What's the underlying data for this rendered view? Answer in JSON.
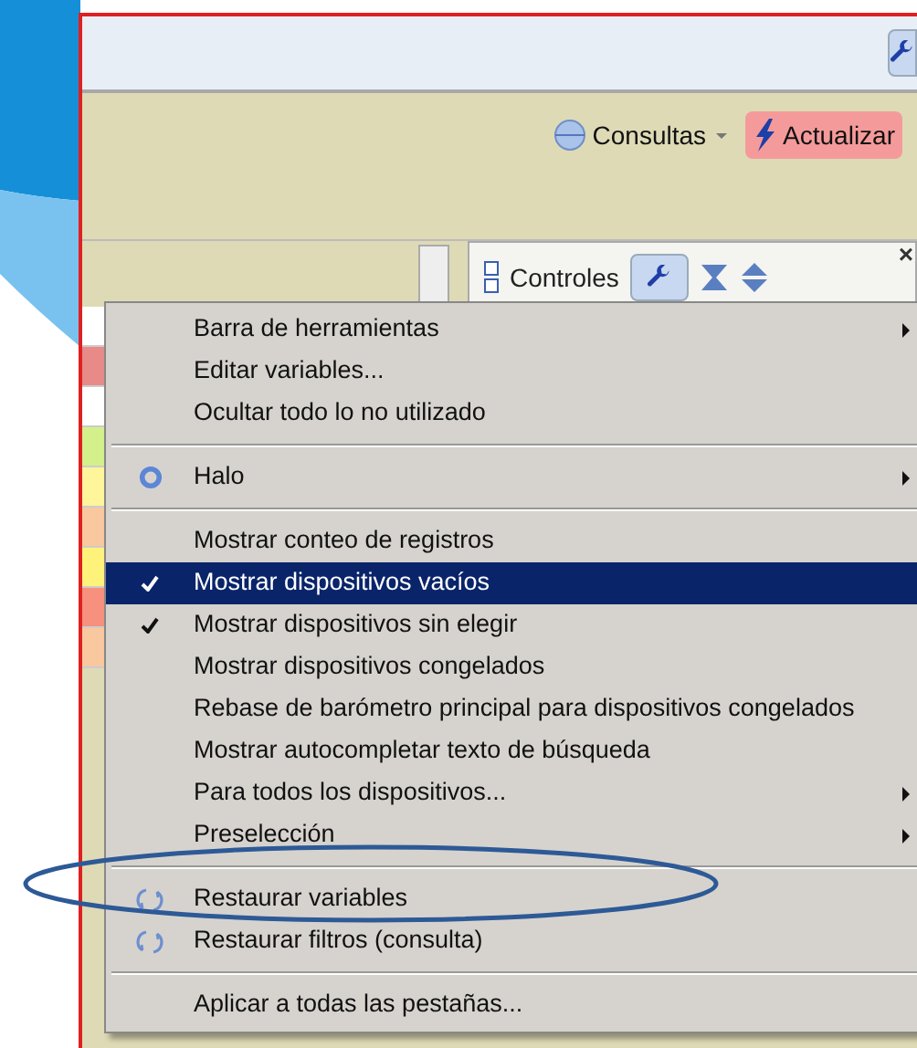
{
  "toolbar": {
    "buttons": [
      {
        "label": "Consultas",
        "kind": "dropdown",
        "highlighted": false
      },
      {
        "label": "Actualizar",
        "kind": "action",
        "highlighted": true
      }
    ]
  },
  "panel": {
    "toolbar": {
      "label": "Controles",
      "close": "×"
    }
  },
  "side_cells": [
    {
      "color": "#ffffff"
    },
    {
      "color": "#e88a88"
    },
    {
      "color": "#ffffff"
    },
    {
      "color": "#d4f08a"
    },
    {
      "color": "#fff59a"
    },
    {
      "color": "#f9c89e"
    },
    {
      "color": "#fff27a"
    },
    {
      "color": "#f7907c"
    },
    {
      "color": "#f9c89e"
    }
  ],
  "menu": {
    "items": [
      {
        "kind": "item",
        "label": "Barra de herramientas",
        "submenu": true,
        "checked": false,
        "selected": false
      },
      {
        "kind": "item",
        "label": "Editar variables...",
        "submenu": false,
        "checked": false,
        "selected": false
      },
      {
        "kind": "item",
        "label": "Ocultar todo lo no utilizado",
        "submenu": false,
        "checked": false,
        "selected": false
      },
      {
        "kind": "separator"
      },
      {
        "kind": "radio",
        "label": "Halo",
        "submenu": true,
        "checked": false,
        "selected": false
      },
      {
        "kind": "separator"
      },
      {
        "kind": "item",
        "label": "Mostrar conteo de registros",
        "submenu": false,
        "checked": false,
        "selected": false
      },
      {
        "kind": "item",
        "label": "Mostrar dispositivos vacíos",
        "submenu": false,
        "checked": true,
        "selected": true
      },
      {
        "kind": "item",
        "label": "Mostrar dispositivos sin elegir",
        "submenu": false,
        "checked": true,
        "selected": false
      },
      {
        "kind": "item",
        "label": "Mostrar dispositivos congelados",
        "submenu": false,
        "checked": false,
        "selected": false
      },
      {
        "kind": "item",
        "label": "Rebase de barómetro principal para dispositivos congelados",
        "submenu": false,
        "checked": false,
        "selected": false
      },
      {
        "kind": "item",
        "label": "Mostrar autocompletar texto de búsqueda",
        "submenu": false,
        "checked": false,
        "selected": false
      },
      {
        "kind": "item",
        "label": "Para todos los dispositivos...",
        "submenu": true,
        "checked": false,
        "selected": false
      },
      {
        "kind": "item",
        "label": "Preselección",
        "submenu": true,
        "checked": false,
        "selected": false
      },
      {
        "kind": "separator"
      },
      {
        "kind": "restore",
        "label": "Restaurar variables",
        "submenu": false,
        "checked": false,
        "selected": false
      },
      {
        "kind": "restore",
        "label": "Restaurar filtros (consulta)",
        "submenu": false,
        "checked": false,
        "selected": false
      },
      {
        "kind": "separator"
      },
      {
        "kind": "item",
        "label": "Aplicar a todas las pestañas...",
        "submenu": false,
        "checked": false,
        "selected": false
      }
    ]
  }
}
